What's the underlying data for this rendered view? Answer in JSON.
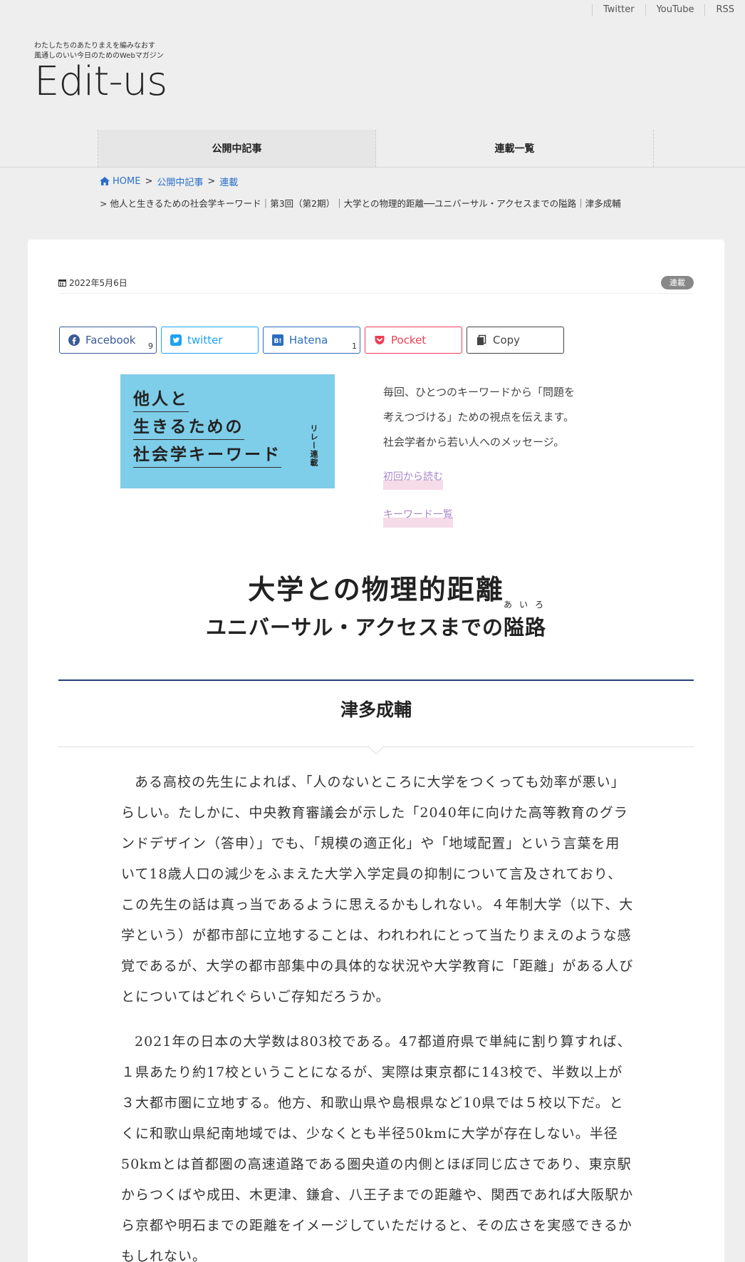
{
  "toplinks": [
    "Twitter",
    "YouTube",
    "RSS"
  ],
  "logo": {
    "tag1": "わたしたちのあたりまえを編みなおす",
    "tag2": "風通しのいい今日のためのWebマガジン",
    "word": "Edit-us"
  },
  "nav": [
    "公開中記事",
    "連載一覧"
  ],
  "breadcrumb": {
    "home": "HOME",
    "sep": ">",
    "c1": "公開中記事",
    "c2": "連載",
    "current": "> 他人と生きるための社会学キーワード｜第3回（第2期）｜大学との物理的距離──ユニバーサル・アクセスまでの隘路｜津多成輔"
  },
  "meta": {
    "date": "2022年5月6日",
    "badge": "連載"
  },
  "share": {
    "facebook": "Facebook",
    "facebook_count": "9",
    "twitter": "twitter",
    "hatena": "Hatena",
    "hatena_count": "1",
    "pocket": "Pocket",
    "copy": "Copy"
  },
  "banner": {
    "line1": "他人と",
    "line2": "生きるための",
    "line3": "社会学キーワード",
    "vertical": "リレー連載"
  },
  "intro": {
    "l1": "毎回、ひとつのキーワードから「問題を",
    "l2": "考えつづける」ための視点を伝えます。",
    "l3": "社会学者から若い人へのメッセージ。",
    "link1": "初回から読む",
    "link2": "キーワード一覧"
  },
  "title": {
    "main": "大学との物理的距離",
    "sub": "ユニバーサル・アクセスまでの隘路",
    "ruby": "あいろ"
  },
  "author": "津多成輔",
  "body": [
    "ある高校の先生によれば、「人のないところに大学をつくっても効率が悪い」らしい。たしかに、中央教育審議会が示した「2040年に向けた高等教育のグランドデザイン（答申）」でも、「規模の適正化」や「地域配置」という言葉を用いて18歳人口の減少をふまえた大学入学定員の抑制について言及されており、この先生の話は真っ当であるように思えるかもしれない。４年制大学（以下、大学という）が都市部に立地することは、われわれにとって当たりまえのような感覚であるが、大学の都市部集中の具体的な状況や大学教育に「距離」がある人びとについてはどれぐらいご存知だろうか。",
    "2021年の日本の大学数は803校である。47都道府県で単純に割り算すれば、１県あたり約17校ということになるが、実際は東京都に143校で、半数以上が３大都市圏に立地する。他方、和歌山県や島根県など10県では５校以下だ。とくに和歌山県紀南地域では、少なくとも半径50kmに大学が存在しない。半径50kmとは首都圏の高速道路である圏央道の内側とほぼ同じ広さであり、東京駅からつくばや成田、木更津、鎌倉、八王子までの距離や、関西であれば大阪駅から京都や明石までの距離をイメージしていただけると、その広さを実感できるかもしれない。"
  ]
}
